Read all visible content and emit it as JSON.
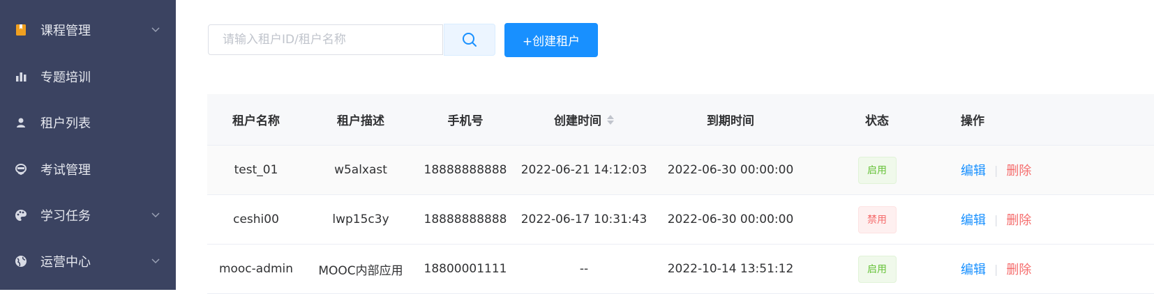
{
  "sidebar": {
    "items": [
      {
        "label": "课程管理",
        "icon": "book-icon",
        "has_chevron": true
      },
      {
        "label": "专题培训",
        "icon": "bar-chart-icon",
        "has_chevron": false
      },
      {
        "label": "租户列表",
        "icon": "user-icon",
        "has_chevron": false
      },
      {
        "label": "考试管理",
        "icon": "exam-icon",
        "has_chevron": false
      },
      {
        "label": "学习任务",
        "icon": "palette-icon",
        "has_chevron": true
      },
      {
        "label": "运营中心",
        "icon": "globe-icon",
        "has_chevron": true
      }
    ]
  },
  "toolbar": {
    "search_placeholder": "请输入租户ID/租户名称",
    "search_value": "",
    "create_label": "+创建租户"
  },
  "table": {
    "headers": [
      "租户名称",
      "租户描述",
      "手机号",
      "创建时间",
      "到期时间",
      "状态",
      "操作"
    ],
    "rows": [
      {
        "name": "test_01",
        "desc": "w5alxast",
        "phone": "18888888888",
        "created": "2022-06-21 14:12:03",
        "expires": "2022-06-30 00:00:00",
        "status": "启用",
        "status_type": "enabled"
      },
      {
        "name": "ceshi00",
        "desc": "lwp15c3y",
        "phone": "18888888888",
        "created": "2022-06-17 10:31:43",
        "expires": "2022-06-30 00:00:00",
        "status": "禁用",
        "status_type": "disabled"
      },
      {
        "name": "mooc-admin",
        "desc": "MOOC内部应用",
        "phone": "18800001111",
        "created": "--",
        "expires": "2022-10-14 13:51:12",
        "status": "启用",
        "status_type": "enabled"
      }
    ],
    "action_edit": "编辑",
    "action_sep": "|",
    "action_delete": "删除"
  },
  "colors": {
    "sidebar_bg": "#3b4361",
    "primary": "#1890ff",
    "danger": "#f56c6c",
    "success": "#67c23a"
  }
}
